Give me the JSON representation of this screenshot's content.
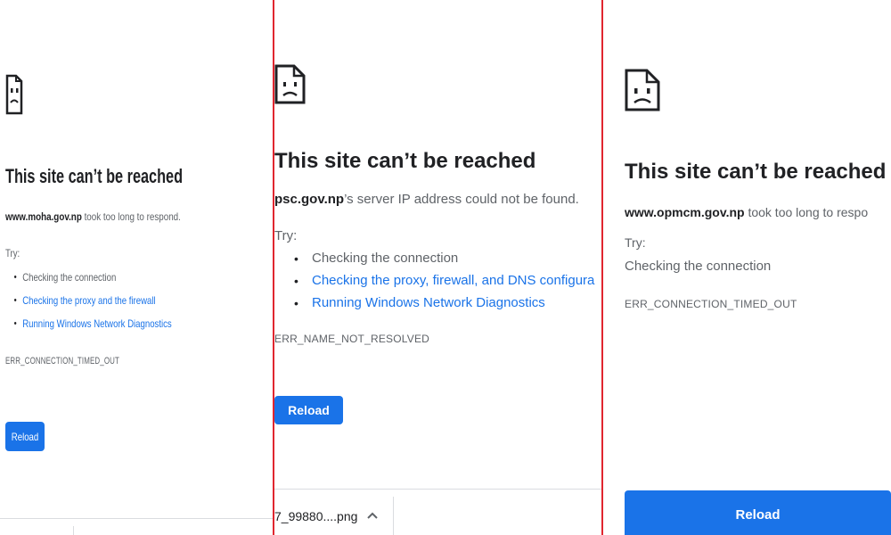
{
  "panels": [
    {
      "title": "This site can’t be reached",
      "host": "www.moha.gov.np",
      "message": " took too long to respond.",
      "try_label": "Try:",
      "suggestions": [
        "Checking the connection",
        "Checking the proxy and the firewall",
        "Running Windows Network Diagnostics"
      ],
      "error_code": "ERR_CONNECTION_TIMED_OUT",
      "reload_label": "Reload"
    },
    {
      "title": "This site can’t be reached",
      "host": "psc.gov.np",
      "message": "’s server IP address could not be found.",
      "try_label": "Try:",
      "suggestions": [
        "Checking the connection",
        "Checking the proxy, firewall, and DNS configura",
        "Running Windows Network Diagnostics"
      ],
      "error_code": "ERR_NAME_NOT_RESOLVED",
      "reload_label": "Reload",
      "download": {
        "filename": "7_99880....png"
      }
    },
    {
      "title": "This site can’t be reached",
      "host": "www.opmcm.gov.np",
      "message": " took too long to respo",
      "try_label": "Try:",
      "suggestions": [
        "Checking the connection"
      ],
      "error_code": "ERR_CONNECTION_TIMED_OUT",
      "reload_label": "Reload"
    }
  ],
  "icons": [
    "sad-page-icon",
    "chevron-up-icon"
  ],
  "colors": {
    "accent": "#1a73e8",
    "divider": "#e0262f",
    "text": "#202124",
    "muted": "#5f6368"
  }
}
